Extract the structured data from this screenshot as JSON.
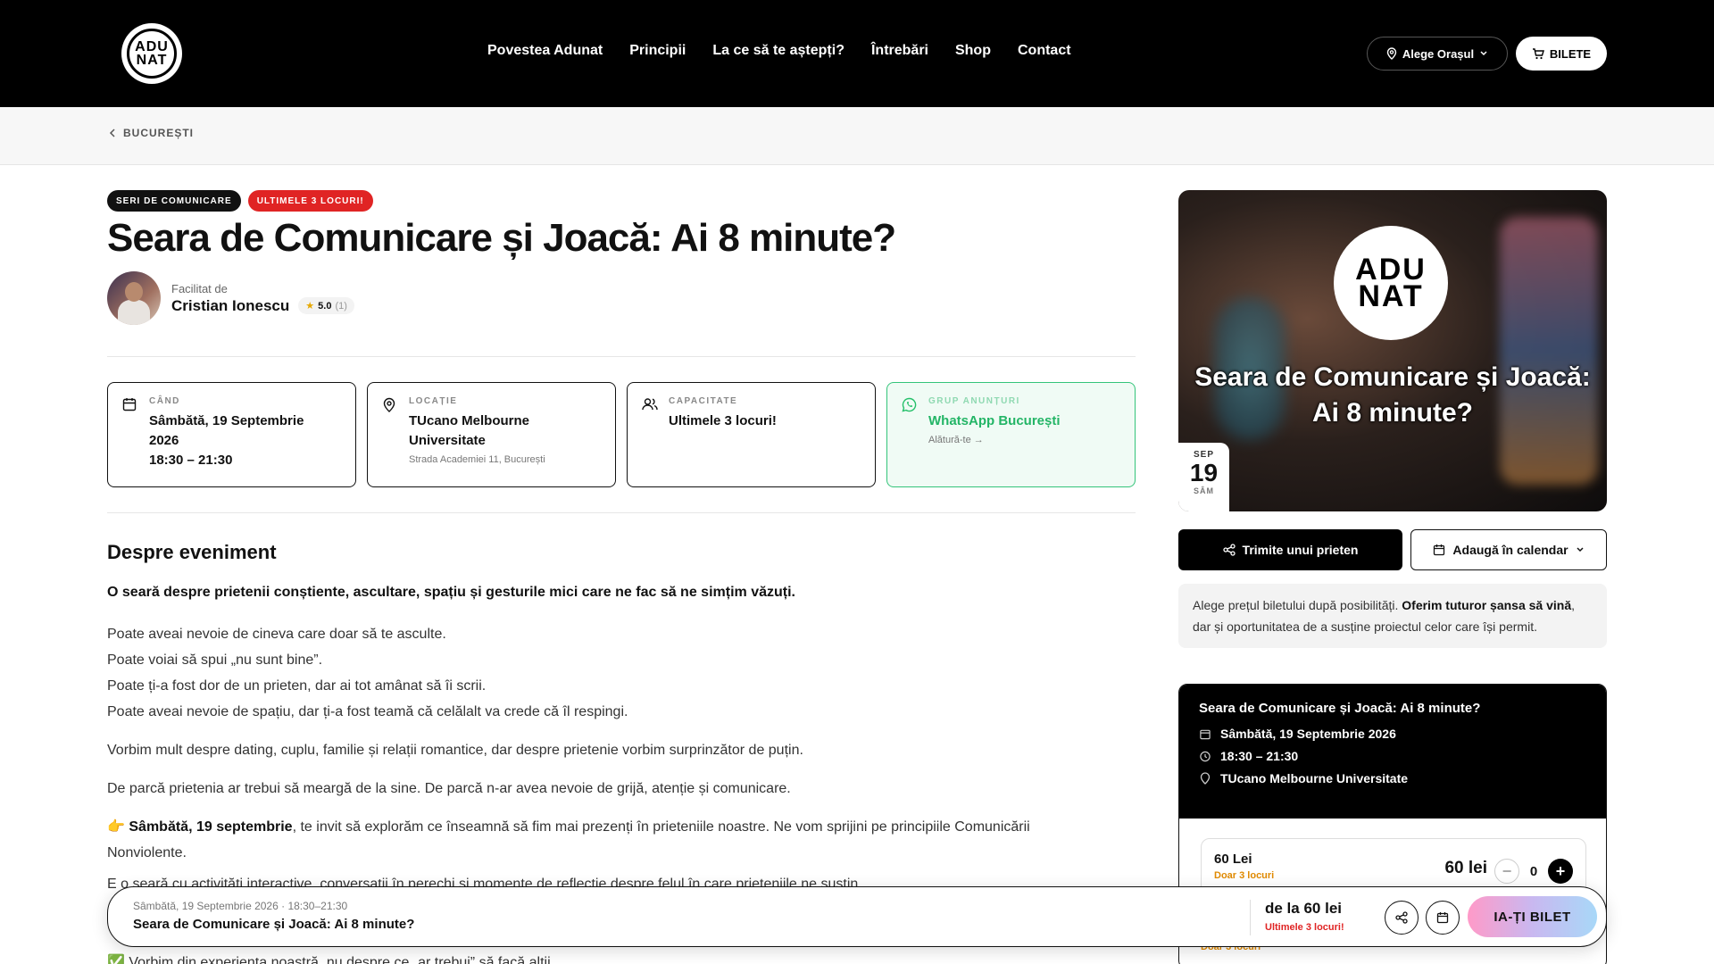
{
  "header": {
    "logo_line1": "ADU",
    "logo_line2": "NAT",
    "nav": [
      "Povestea Adunat",
      "Principii",
      "La ce să te aștepți?",
      "Întrebări",
      "Shop",
      "Contact"
    ],
    "city_button": "Alege Orașul",
    "tickets_button": "BILETE"
  },
  "breadcrumb": {
    "label": "BUCUREȘTI"
  },
  "event": {
    "badges": [
      "SERI DE COMUNICARE",
      "ULTIMELE 3 LOCURI!"
    ],
    "title": "Seara de Comunicare și Joacă: Ai 8 minute?",
    "facilitated_by_label": "Facilitat de",
    "facilitator": "Cristian Ionescu",
    "rating": "5.0",
    "rating_count": "(1)"
  },
  "cards": {
    "when": {
      "label": "CÂND",
      "line1": "Sâmbătă, 19 Septembrie",
      "line2": "2026",
      "time": "18:30 – 21:30"
    },
    "location": {
      "label": "LOCAȚIE",
      "line1": "TUcano Melbourne",
      "line2": "Universitate",
      "address": "Strada Academiei 11, București"
    },
    "capacity": {
      "label": "CAPACITATE",
      "value": "Ultimele 3 locuri!"
    },
    "group": {
      "label": "GRUP ANUNȚURI",
      "value": "WhatsApp București",
      "cta": "Alătură-te →"
    }
  },
  "about": {
    "heading": "Despre eveniment",
    "lead": "O seară despre prietenii conștiente, ascultare, spațiu și gesturile mici care ne fac să ne simțim văzuți.",
    "lines": [
      "Poate aveai nevoie de cineva care doar să te asculte.",
      "Poate voiai să spui „nu sunt bine”.",
      "Poate ți-a fost dor de un prieten, dar ai tot amânat să îi scrii.",
      "Poate aveai nevoie de spațiu, dar ți-a fost teamă că celălalt va crede că îl respingi."
    ],
    "p2": "Vorbim mult despre dating, cuplu, familie și relații romantice, dar despre prietenie vorbim surprinzător de puțin.",
    "p3": "De parcă prietenia ar trebui să meargă de la sine. De parcă n-ar avea nevoie de grijă, atenție și comunicare.",
    "p4_emoji": "👉",
    "p4_bold": "Sâmbătă, 19 septembrie",
    "p4_rest": ", te invit să explorăm ce înseamnă să fim mai prezenți în prieteniile noastre. Ne vom sprijini pe principiile Comunicării Nonviolente.",
    "p5": "E o seară cu activități interactive, conversații în perechi și momente de reflecție despre felul în care prieteniile ne susțin.",
    "p6": "✅ Vorbim din experiența noastră, nu despre ce „ar trebui” să facă alții."
  },
  "hero": {
    "logo_line1": "ADU",
    "logo_line2": "NAT",
    "title": "Seara de Comunicare și Joacă: Ai 8 minute?",
    "month": "SEP",
    "day": "19",
    "weekday": "SÂM"
  },
  "actions": {
    "share": "Trimite unui prieten",
    "calendar": "Adaugă în calendar"
  },
  "price_note": {
    "part1": "Alege prețul biletului după posibilități. ",
    "bold": "Oferim tuturor șansa să vină",
    "part2": ", dar și oportunitatea de a susține proiectul celor care își permit."
  },
  "ticket_panel": {
    "title": "Seara de Comunicare și Joacă: Ai 8 minute?",
    "date": "Sâmbătă, 19 Septembrie 2026",
    "time": "18:30 – 21:30",
    "venue": "TUcano Melbourne Universitate",
    "option_name": "60 Lei",
    "option_avail": "Doar 3 locuri",
    "option_price": "60 lei",
    "quantity": "0",
    "option2_avail": "Doar 3 locuri"
  },
  "sticky": {
    "subtitle": "Sâmbătă, 19 Septembrie 2026 · 18:30–21:30",
    "title": "Seara de Comunicare și Joacă: Ai 8 minute?",
    "price": "de la 60 lei",
    "availability": "Ultimele 3 locuri!",
    "buy": "IA-ȚI BILET"
  },
  "colors": {
    "accent_red": "#e02424",
    "whatsapp_green": "#23b566",
    "warning_orange": "#e08a00"
  },
  "icons": [
    "location-pin-icon",
    "cart-icon",
    "chevron-left-icon",
    "star-icon",
    "calendar-icon",
    "pin-icon",
    "users-icon",
    "whatsapp-icon",
    "share-icon",
    "clock-icon"
  ]
}
